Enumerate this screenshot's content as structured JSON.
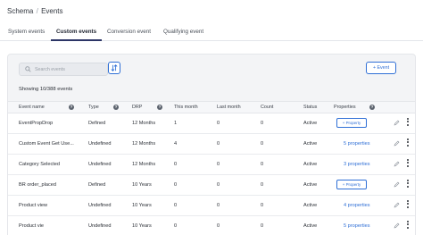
{
  "breadcrumb": {
    "parent": "Schema",
    "separator": "/",
    "current": "Events"
  },
  "tabs": [
    {
      "label": "System events",
      "active": false
    },
    {
      "label": "Custom events",
      "active": true
    },
    {
      "label": "Conversion event",
      "active": false
    },
    {
      "label": "Qualifying event",
      "active": false
    }
  ],
  "toolbar": {
    "search_placeholder": "Search events",
    "sort_icon": "sort-icon",
    "add_event_label": "+ Event"
  },
  "showing_text": "Showing 10/388 events",
  "table": {
    "columns": [
      "Event name",
      "Type",
      "DRP",
      "This month",
      "Last month",
      "Count",
      "Status",
      "Properties"
    ],
    "info_columns": [
      "Event name",
      "Type",
      "DRP",
      "Properties"
    ],
    "info_glyph": "?",
    "add_property_label": "+ Property",
    "rows": [
      {
        "name": "EventPropDrop",
        "type": "Defined",
        "drp": "12 Months",
        "this_month": "1",
        "last_month": "0",
        "count": "0",
        "status": "Active",
        "properties": "+ Property"
      },
      {
        "name": "Custom Event Get Use...",
        "type": "Undefined",
        "drp": "12 Months",
        "this_month": "4",
        "last_month": "0",
        "count": "0",
        "status": "Active",
        "properties": "5 properties"
      },
      {
        "name": "Category Selected",
        "type": "Undefined",
        "drp": "12 Months",
        "this_month": "0",
        "last_month": "0",
        "count": "0",
        "status": "Active",
        "properties": "3 properties"
      },
      {
        "name": "BR order_placed",
        "type": "Defined",
        "drp": "10 Years",
        "this_month": "0",
        "last_month": "0",
        "count": "0",
        "status": "Active",
        "properties": "+ Property"
      },
      {
        "name": "Product view",
        "type": "Undefined",
        "drp": "10 Years",
        "this_month": "0",
        "last_month": "0",
        "count": "0",
        "status": "Active",
        "properties": "4 properties"
      },
      {
        "name": "Product vie",
        "type": "Undefined",
        "drp": "10 Years",
        "this_month": "0",
        "last_month": "0",
        "count": "0",
        "status": "Active",
        "properties": "5 properties"
      }
    ]
  },
  "colors": {
    "accent": "#2f6fd6",
    "tab_underline": "#2c3566",
    "card_bg": "#f3f4f6"
  }
}
